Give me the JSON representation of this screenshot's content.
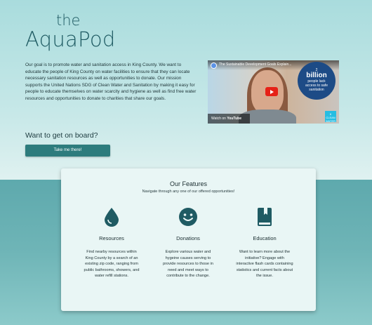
{
  "brand": {
    "the": "the",
    "name": "AquaPod"
  },
  "mission_text": "Our goal is to promote water and sanitation access in King County. We want to educate the people of King County on water facilities to ensure that they can locate necessary sanitation resources as well as opportunities to donate. Our mission supports the United Nations SDG of Clean Water and Sanitation by making it easy for people to educate themselves on water scarcity and hygiene as well as find free water resources and opportunities to donate to charities that share our goals.",
  "video": {
    "title": "The Sustainable Development Goals Explain...",
    "watch_label": "Watch on",
    "platform": "YouTube",
    "overlay_line1": "2",
    "overlay_big": "billion",
    "overlay_line2": "people lack",
    "overlay_line3": "access to safe sanitation",
    "sdg_label": "6 CLEAN WATER"
  },
  "cta": {
    "heading": "Want to get on board?",
    "button_label": "Take me there!"
  },
  "features": {
    "title": "Our Features",
    "subtitle": "Navigate through any one of our offered opportunities!",
    "items": [
      {
        "icon": "water-drop-icon",
        "title": "Resources",
        "text": "Find nearby resources within King County by a search of an existing zip code, ranging from public bathrooms, showers, and water refill stations."
      },
      {
        "icon": "smiley-face-icon",
        "title": "Donations",
        "text": "Explore various water and hygeine causes serving to provide resources to those in need and meet ways to contribute to the change."
      },
      {
        "icon": "book-icon",
        "title": "Education",
        "text": "Want to learn more about the initiative? Engage with interactive flash cards containing statistics and current facts about the issue."
      }
    ]
  },
  "colors": {
    "accent": "#2d7c7d",
    "icon": "#1f5b63",
    "band": "#6fb5b7"
  }
}
